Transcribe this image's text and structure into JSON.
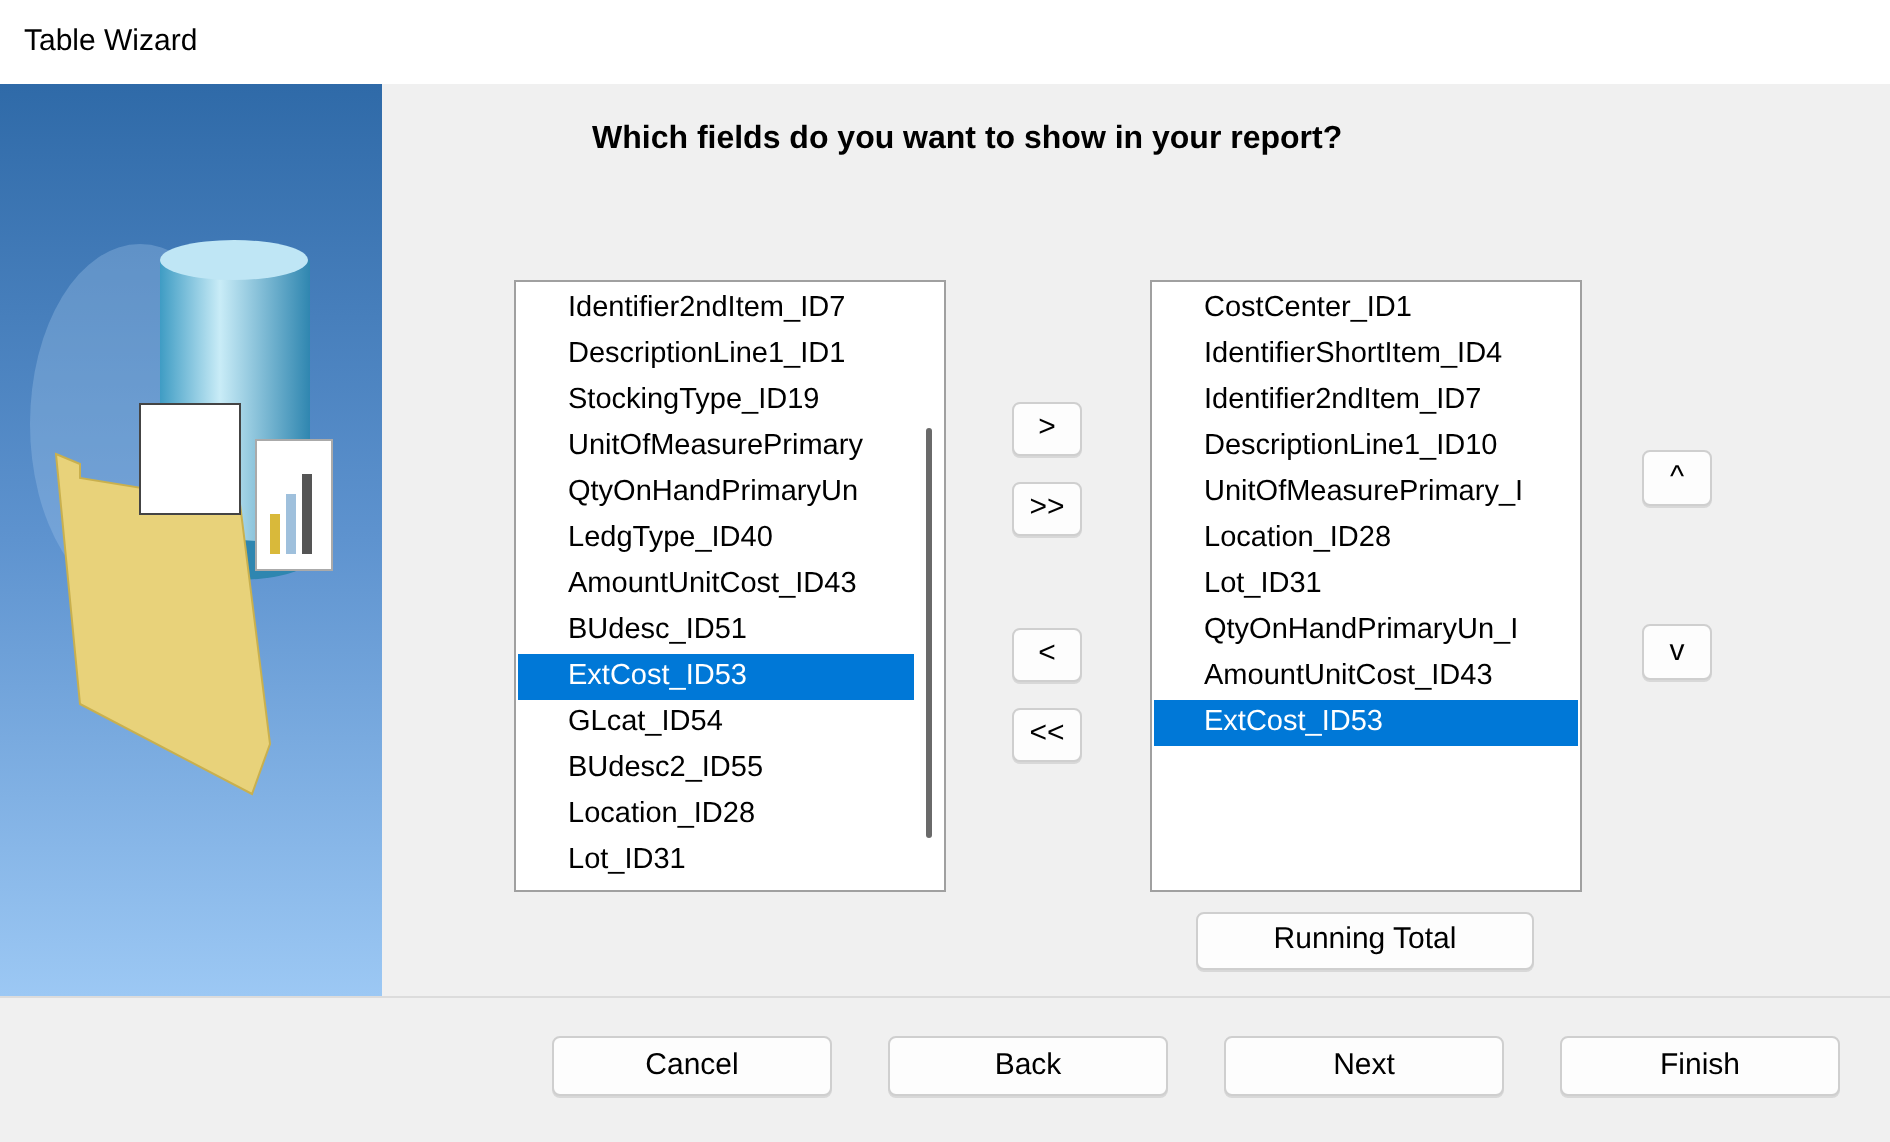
{
  "window": {
    "title": "Table Wizard"
  },
  "heading": "Which fields do you want to show in your report?",
  "available_fields": [
    {
      "label": "Identifier2ndItem_ID7",
      "selected": false
    },
    {
      "label": "DescriptionLine1_ID1",
      "selected": false
    },
    {
      "label": "StockingType_ID19",
      "selected": false
    },
    {
      "label": "UnitOfMeasurePrimary",
      "selected": false
    },
    {
      "label": "QtyOnHandPrimaryUn",
      "selected": false
    },
    {
      "label": "LedgType_ID40",
      "selected": false
    },
    {
      "label": "AmountUnitCost_ID43",
      "selected": false
    },
    {
      "label": "BUdesc_ID51",
      "selected": false
    },
    {
      "label": "ExtCost_ID53",
      "selected": true
    },
    {
      "label": "GLcat_ID54",
      "selected": false
    },
    {
      "label": "BUdesc2_ID55",
      "selected": false
    },
    {
      "label": "Location_ID28",
      "selected": false
    },
    {
      "label": "Lot_ID31",
      "selected": false
    }
  ],
  "move_buttons": [
    ">",
    ">>",
    "<",
    "<<"
  ],
  "selected_fields": [
    {
      "label": "CostCenter_ID1",
      "selected": false
    },
    {
      "label": "IdentifierShortItem_ID4",
      "selected": false
    },
    {
      "label": "Identifier2ndItem_ID7",
      "selected": false
    },
    {
      "label": "DescriptionLine1_ID10",
      "selected": false
    },
    {
      "label": "UnitOfMeasurePrimary_I",
      "selected": false
    },
    {
      "label": "Location_ID28",
      "selected": false
    },
    {
      "label": "Lot_ID31",
      "selected": false
    },
    {
      "label": "QtyOnHandPrimaryUn_I",
      "selected": false
    },
    {
      "label": "AmountUnitCost_ID43",
      "selected": false
    },
    {
      "label": "ExtCost_ID53",
      "selected": true
    }
  ],
  "order_buttons": [
    "^",
    "v"
  ],
  "running_total_button": "Running Total",
  "footer_buttons": [
    "Cancel",
    "Back",
    "Next",
    "Finish"
  ]
}
